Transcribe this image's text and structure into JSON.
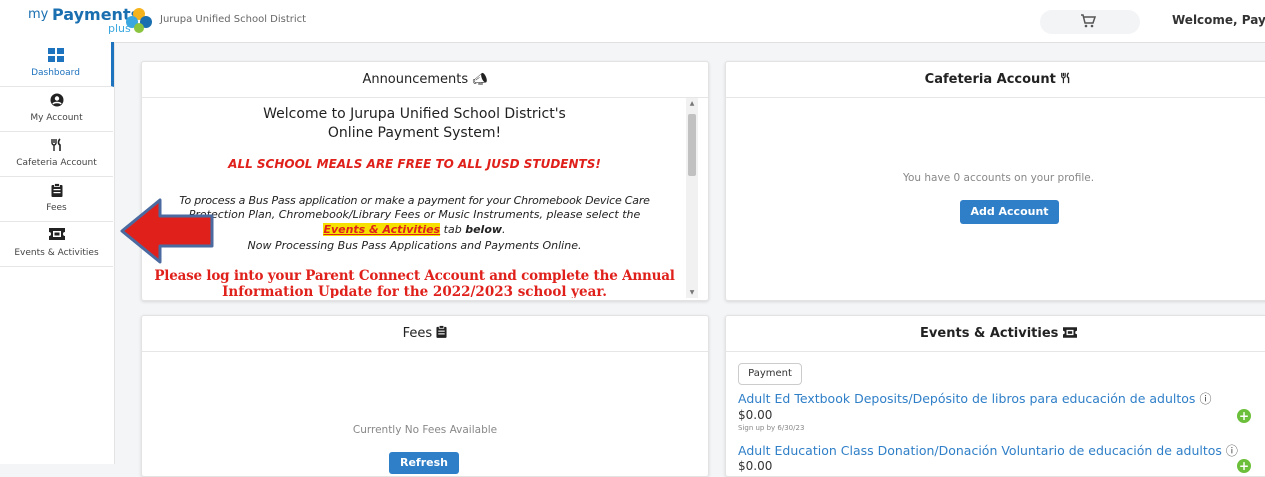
{
  "header": {
    "logo_my": "my",
    "logo_payments": "Payments",
    "logo_plus": "plus",
    "district": "Jurupa Unified School District",
    "welcome": "Welcome, Pay"
  },
  "sidebar": {
    "items": [
      {
        "label": "Dashboard",
        "icon": "dashboard-icon"
      },
      {
        "label": "My Account",
        "icon": "user-icon"
      },
      {
        "label": "Cafeteria Account",
        "icon": "fork-knife-icon"
      },
      {
        "label": "Fees",
        "icon": "clipboard-icon"
      },
      {
        "label": "Events & Activities",
        "icon": "ticket-icon"
      }
    ]
  },
  "announcements": {
    "title": "Announcements",
    "welcome_line1": "Welcome to Jurupa Unified School District's",
    "welcome_line2": "Online Payment System!",
    "meals": "ALL SCHOOL MEALS ARE FREE TO ALL JUSD STUDENTS!",
    "process_line1": "To process a Bus Pass application or make a payment for your Chromebook Device Care",
    "process_line2": "Protection Plan, Chromebook/Library Fees or Music Instruments, please select the",
    "link": "Events & Activities",
    "tab_text": " tab ",
    "below": "below",
    "period": ".",
    "now_processing": "Now Processing Bus Pass Applications and Payments Online.",
    "parent_line1": "Please log into your Parent Connect Account and complete the Annual",
    "parent_line2": "Information Update for the 2022/2023 school year."
  },
  "cafeteria": {
    "title": "Cafeteria Account",
    "empty": "You have 0 accounts on your profile.",
    "add_button": "Add Account"
  },
  "fees": {
    "title": "Fees",
    "empty": "Currently No Fees Available",
    "refresh": "Refresh"
  },
  "events": {
    "title": "Events & Activities",
    "filter": "Payment",
    "items": [
      {
        "title": "Adult Ed Textbook Deposits/Depósito de libros para educación de adultos",
        "amount": "$0.00",
        "signup": "Sign up by 6/30/23"
      },
      {
        "title": "Adult Education Class Donation/Donación Voluntario de educación de adultos",
        "amount": "$0.00"
      }
    ]
  },
  "colors": {
    "accent": "#2f7fc8",
    "alert_red": "#e0201b",
    "add_green": "#6cbf3a",
    "arrow_red": "#e0201b",
    "arrow_outline": "#4a6aa0"
  }
}
